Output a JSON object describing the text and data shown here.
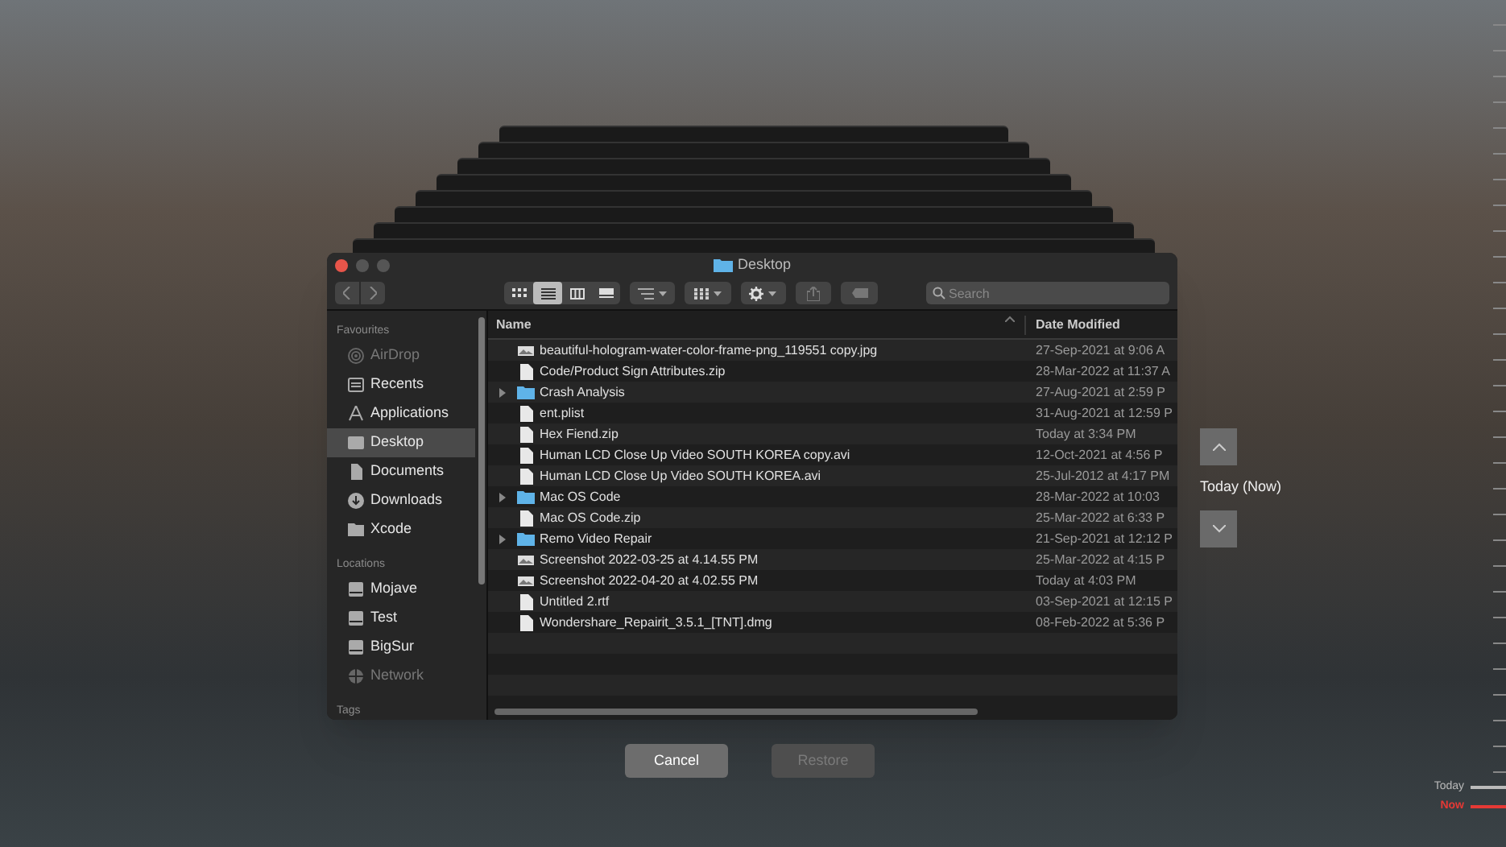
{
  "window": {
    "title": "Desktop"
  },
  "toolbar": {
    "view_modes": [
      {
        "kind": "icons",
        "selected": false
      },
      {
        "kind": "list",
        "selected": true
      },
      {
        "kind": "columns",
        "selected": false
      },
      {
        "kind": "gallery",
        "selected": false
      }
    ],
    "search": {
      "placeholder": "Search"
    }
  },
  "sidebar": [
    {
      "heading": "Favourites",
      "items": [
        {
          "label": "AirDrop",
          "kind": "airdrop",
          "selected": false,
          "disabled": true
        },
        {
          "label": "Recents",
          "kind": "recents",
          "selected": false,
          "disabled": false
        },
        {
          "label": "Applications",
          "kind": "apps",
          "selected": false,
          "disabled": false
        },
        {
          "label": "Desktop",
          "kind": "desktop",
          "selected": true,
          "disabled": false
        },
        {
          "label": "Documents",
          "kind": "doc",
          "selected": false,
          "disabled": false
        },
        {
          "label": "Downloads",
          "kind": "download",
          "selected": false,
          "disabled": false
        },
        {
          "label": "Xcode",
          "kind": "folder",
          "selected": false,
          "disabled": false
        }
      ]
    },
    {
      "heading": "Locations",
      "items": [
        {
          "label": "Mojave",
          "kind": "disk",
          "selected": false,
          "disabled": false
        },
        {
          "label": "Test",
          "kind": "disk",
          "selected": false,
          "disabled": false
        },
        {
          "label": "BigSur",
          "kind": "disk",
          "selected": false,
          "disabled": false
        },
        {
          "label": "Network",
          "kind": "network",
          "selected": false,
          "disabled": true
        }
      ]
    },
    {
      "heading": "Tags"
    }
  ],
  "table": {
    "columns": [
      "Name",
      "Date Modified"
    ],
    "rows": [
      {
        "name": "beautiful-hologram-water-color-frame-png_119551 copy.jpg",
        "date": "27-Sep-2021 at 9:06 A",
        "kind": "image"
      },
      {
        "name": "Code/Product Sign Attributes.zip",
        "date": "28-Mar-2022 at 11:37 A",
        "kind": "file"
      },
      {
        "name": "Crash Analysis",
        "date": "27-Aug-2021 at 2:59 P",
        "kind": "folder",
        "expanded": false
      },
      {
        "name": "ent.plist",
        "date": "31-Aug-2021 at 12:59 P",
        "kind": "file"
      },
      {
        "name": "Hex Fiend.zip",
        "date": "Today at 3:34 PM",
        "kind": "file"
      },
      {
        "name": "Human LCD  Close Up Video  SOUTH KOREA copy.avi",
        "date": "12-Oct-2021 at 4:56 P",
        "kind": "file"
      },
      {
        "name": "Human LCD  Close Up Video  SOUTH KOREA.avi",
        "date": "25-Jul-2012 at 4:17 PM",
        "kind": "file"
      },
      {
        "name": "Mac OS Code",
        "date": "28-Mar-2022 at 10:03",
        "kind": "folder",
        "expanded": false
      },
      {
        "name": "Mac OS Code.zip",
        "date": "25-Mar-2022 at 6:33 P",
        "kind": "file"
      },
      {
        "name": "Remo Video Repair",
        "date": "21-Sep-2021 at 12:12 P",
        "kind": "folder",
        "expanded": false
      },
      {
        "name": "Screenshot 2022-03-25 at 4.14.55 PM",
        "date": "25-Mar-2022 at 4:15 P",
        "kind": "image"
      },
      {
        "name": "Screenshot 2022-04-20 at 4.02.55 PM",
        "date": "Today at 4:03 PM",
        "kind": "image"
      },
      {
        "name": "Untitled 2.rtf",
        "date": "03-Sep-2021 at 12:15 P",
        "kind": "file"
      },
      {
        "name": "Wondershare_Repairit_3.5.1_[TNT].dmg",
        "date": "08-Feb-2022 at 5:36 P",
        "kind": "file"
      }
    ]
  },
  "buttons": [
    {
      "label": "Cancel",
      "disabled": false
    },
    {
      "label": "Restore",
      "disabled": true
    }
  ],
  "navigator": {
    "label": "Today (Now)"
  },
  "timeline": [
    {
      "label": "Today",
      "kind": "past"
    },
    {
      "label": "Now",
      "kind": "current"
    }
  ]
}
